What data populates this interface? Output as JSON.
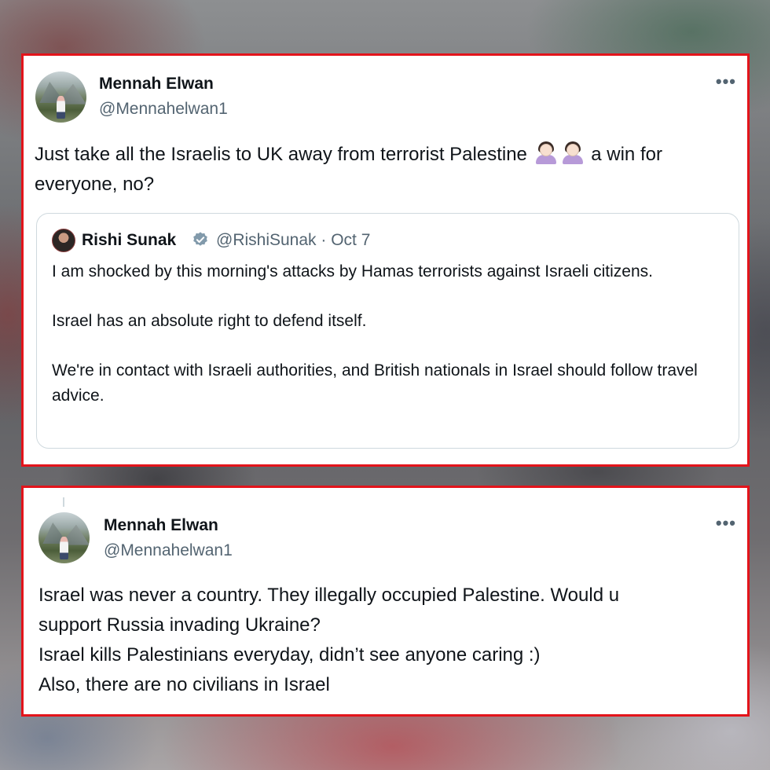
{
  "tweet_1": {
    "author_name": "Mennah Elwan",
    "author_handle": "@Mennahelwan1",
    "more_icon": "•••",
    "text_before_emoji": "Just take all the Israelis to UK away from terrorist Palestine",
    "emoji": "woman-shrugging-emoji",
    "text_after_emoji": "a win for everyone, no?",
    "quoted": {
      "author_name": "Rishi Sunak",
      "verified_icon": "verified-badge-icon",
      "handle_and_date": "@RishiSunak · Oct 7",
      "paragraphs": [
        "I am shocked by this morning's attacks by Hamas terrorists against Israeli citizens.",
        "Israel has an absolute right to defend itself.",
        "We're in contact with Israeli authorities, and British nationals in Israel should follow travel advice."
      ]
    }
  },
  "tweet_2": {
    "author_name": "Mennah Elwan",
    "author_handle": "@Mennahelwan1",
    "more_icon": "•••",
    "lines": [
      "Israel was never a country. They illegally occupied Palestine. Would u",
      "support Russia invading Ukraine?",
      "Israel kills Palestinians everyday, didn’t see anyone caring :)",
      "Also, there are no civilians in Israel"
    ]
  },
  "colors": {
    "highlight_border": "#e3141b",
    "text_primary": "#0f1419",
    "text_secondary": "#536471",
    "verified_badge": "#829aab"
  }
}
